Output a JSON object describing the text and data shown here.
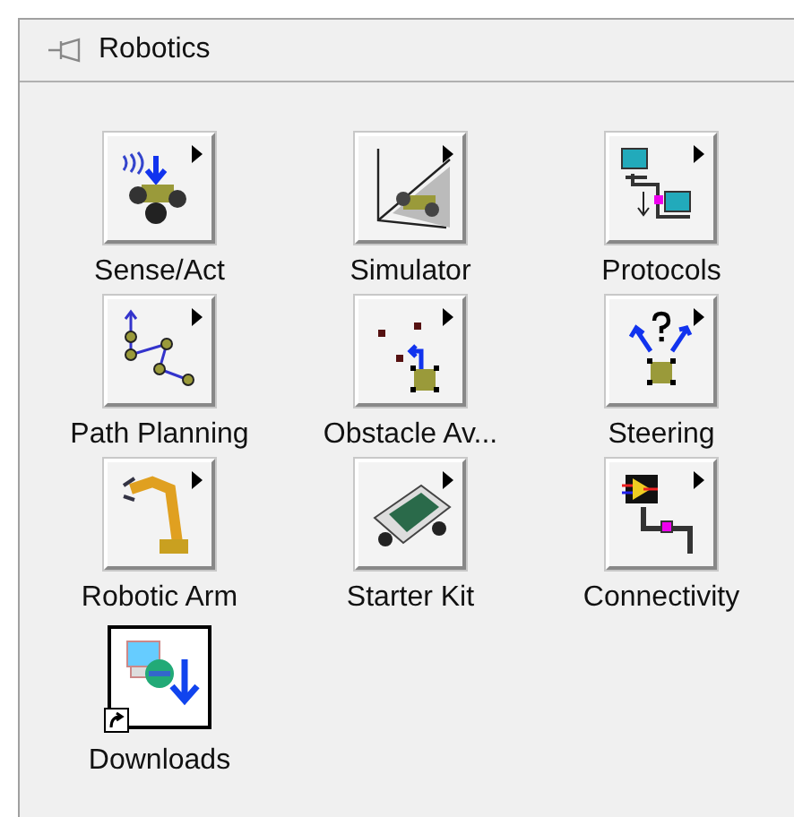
{
  "palette": {
    "title": "Robotics",
    "pinned": false
  },
  "items": [
    {
      "label": "Sense/Act",
      "kind": "folder"
    },
    {
      "label": "Simulator",
      "kind": "folder"
    },
    {
      "label": "Protocols",
      "kind": "folder"
    },
    {
      "label": "Path Planning",
      "kind": "folder"
    },
    {
      "label": "Obstacle Av...",
      "kind": "folder"
    },
    {
      "label": "Steering",
      "kind": "folder"
    },
    {
      "label": "Robotic Arm",
      "kind": "folder"
    },
    {
      "label": "Starter Kit",
      "kind": "folder"
    },
    {
      "label": "Connectivity",
      "kind": "folder"
    },
    {
      "label": "Downloads",
      "kind": "shortcut"
    }
  ]
}
